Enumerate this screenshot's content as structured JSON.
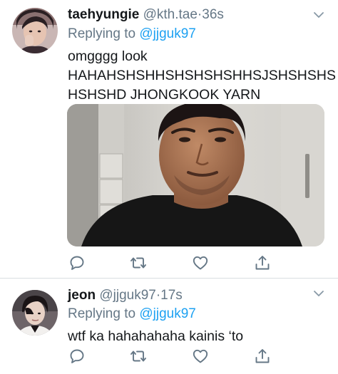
{
  "tweets": [
    {
      "display_name": "taehyungie",
      "handle": "@kth.tae",
      "separator": "·",
      "time": "36s",
      "replying_prefix": "Replying to",
      "replying_to": "@jjguk97",
      "text_lines": [
        "omgggg look",
        "HAHAHSHSHHSHSHSHSHHSJSHSHSHS",
        "HSHSHD JHONGKOOK YARN"
      ]
    },
    {
      "display_name": "jeon",
      "handle": "@jjguk97",
      "separator": "·",
      "time": "17s",
      "replying_prefix": "Replying to",
      "replying_to": "@jjguk97",
      "text_lines": [
        "wtf ka hahahahaha kainis ‘to"
      ]
    }
  ],
  "icons": {
    "reply": "reply-icon",
    "retweet": "retweet-icon",
    "like": "heart-icon",
    "share": "share-icon",
    "menu": "chevron-down-icon"
  },
  "colors": {
    "text": "#14171a",
    "secondary": "#657786",
    "link": "#1da1f2",
    "divider": "#d9dde1"
  }
}
